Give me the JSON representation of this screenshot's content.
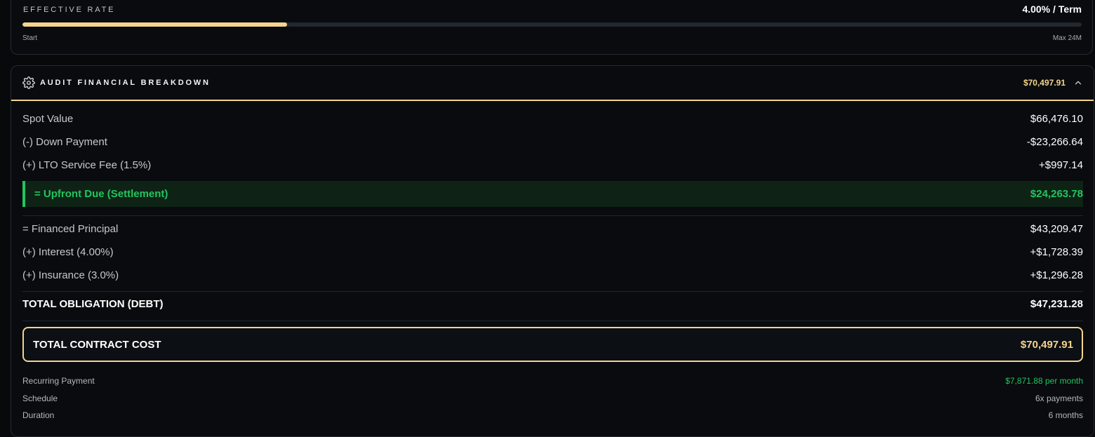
{
  "rate": {
    "label": "EFFECTIVE RATE",
    "value": "4.00% / Term",
    "progress_percent": 25,
    "start_label": "Start",
    "end_label": "Max 24M"
  },
  "audit": {
    "title": "AUDIT FINANCIAL BREAKDOWN",
    "total": "$70,497.91",
    "rows": [
      {
        "label": "Spot Value",
        "value": "$66,476.10"
      },
      {
        "label": "(-) Down Payment",
        "value": "-$23,266.64"
      },
      {
        "label": "(+) LTO Service Fee (1.5%)",
        "value": "+$997.14"
      }
    ],
    "upfront": {
      "label": "= Upfront Due (Settlement)",
      "value": "$24,263.78"
    },
    "financed_rows": [
      {
        "label": "= Financed Principal",
        "value": "$43,209.47"
      },
      {
        "label": "(+) Interest (4.00%)",
        "value": "+$1,728.39"
      },
      {
        "label": "(+) Insurance (3.0%)",
        "value": "+$1,296.28"
      }
    ],
    "debt": {
      "label": "TOTAL OBLIGATION (DEBT)",
      "value": "$47,231.28"
    },
    "contract": {
      "label": "TOTAL CONTRACT COST",
      "value": "$70,497.91"
    },
    "details": [
      {
        "label": "Recurring Payment",
        "value": "$7,871.88 per month"
      },
      {
        "label": "Schedule",
        "value": "6x payments"
      },
      {
        "label": "Duration",
        "value": "6 months"
      }
    ]
  },
  "colors": {
    "gold": "#f4d58d",
    "green": "#22c55e",
    "background": "#07090b"
  }
}
